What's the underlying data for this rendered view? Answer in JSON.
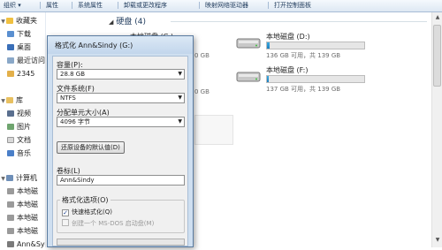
{
  "toolbar": {
    "items": [
      "组织 ▾",
      "属性",
      "系统属性",
      "卸载或更改程序",
      "映射网络驱动器",
      "打开控制面板"
    ]
  },
  "nav": {
    "favorites": "收藏夹",
    "downloads": "下载",
    "desktop": "桌面",
    "recent": "最近访问",
    "item_2345": "2345",
    "libraries": "库",
    "videos": "视频",
    "pictures": "图片",
    "documents": "文档",
    "music": "音乐",
    "computer": "计算机",
    "disk1": "本地磁",
    "disk2": "本地磁",
    "disk3": "本地磁",
    "disk4": "本地磁",
    "annsindy": "Ann&Sy"
  },
  "main": {
    "group_title": "硬盘 (4)",
    "drives": [
      {
        "name": "本地磁盘 (C:)",
        "free": "",
        "fill_pct": 0
      },
      {
        "name": "本地磁盘 (D:)",
        "free": "136 GB 可用，共 139 GB",
        "fill_pct": 3
      },
      {
        "name": "",
        "free": "... GB",
        "fill_pct": 0
      },
      {
        "name": "本地磁盘 (F:)",
        "free": "137 GB 可用，共 139 GB",
        "fill_pct": 2
      }
    ],
    "partial_free": [
      "0 GB",
      "0 GB"
    ]
  },
  "dialog": {
    "title": "格式化 Ann&Sindy (G:)",
    "capacity_label": "容量(P):",
    "capacity_value": "28.8 GB",
    "filesystem_label": "文件系统(F)",
    "filesystem_value": "NTFS",
    "alloc_label": "分配单元大小(A)",
    "alloc_value": "4096 字节",
    "restore_button": "还原设备的默认值(D)",
    "volume_label": "卷标(L)",
    "volume_value": "Ann&Sindy",
    "options_legend": "格式化选项(O)",
    "quick_format": "快速格式化(Q)",
    "msdos_disk": "创建一个 MS-DOS 启动盘(M)",
    "quick_checked": true,
    "progress_pct": 0
  },
  "colors": {
    "accent": "#1c7fc0",
    "toolbar_text": "#1e395b"
  }
}
